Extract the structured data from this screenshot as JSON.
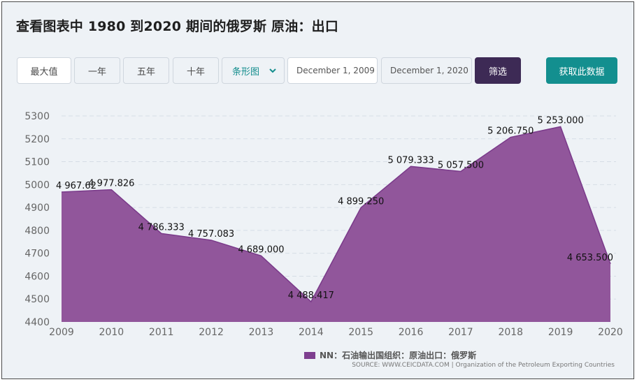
{
  "title": "查看图表中 1980 到2020 期间的俄罗斯 原油：出口",
  "toolbar": {
    "range_buttons": [
      "最大值",
      "一年",
      "五年",
      "十年"
    ],
    "chart_type_selected": "条形图",
    "start_date": "December 1, 2009",
    "end_date": "December 1, 2020",
    "filter_label": "筛选",
    "fetch_label": "获取此数据"
  },
  "colors": {
    "area_fill": "#91569b",
    "area_line": "#7a3a8a",
    "filter_bg": "#3d2a55",
    "fetch_bg": "#138f8f"
  },
  "legend": {
    "label": "NN：石油输出国组织：原油出口：俄罗斯"
  },
  "source": "SOURCE: WWW.CEICDATA.COM | Organization of the Petroleum Exporting Countries",
  "chart_data": {
    "type": "area",
    "x": [
      "2009",
      "2010",
      "2011",
      "2012",
      "2013",
      "2014",
      "2015",
      "2016",
      "2017",
      "2018",
      "2019",
      "2020"
    ],
    "series": [
      {
        "values": [
          4967.62,
          4977.826,
          4786.333,
          4757.083,
          4689.0,
          4488.417,
          4899.25,
          5079.333,
          5057.5,
          5206.75,
          5253.0,
          4653.5
        ],
        "labels": [
          "4 967.62",
          "4 977.826",
          "4 786.333",
          "4 757.083",
          "4 689.000",
          "4 488.417",
          "4 899.250",
          "5 079.333",
          "5 057.500",
          "5 206.750",
          "5 253.000",
          "4 653.500"
        ]
      }
    ],
    "yticks": [
      4400,
      4500,
      4600,
      4700,
      4800,
      4900,
      5000,
      5100,
      5200,
      5300
    ],
    "ylim": [
      4400,
      5300
    ],
    "grid": true,
    "legend_position": "bottom-right"
  }
}
